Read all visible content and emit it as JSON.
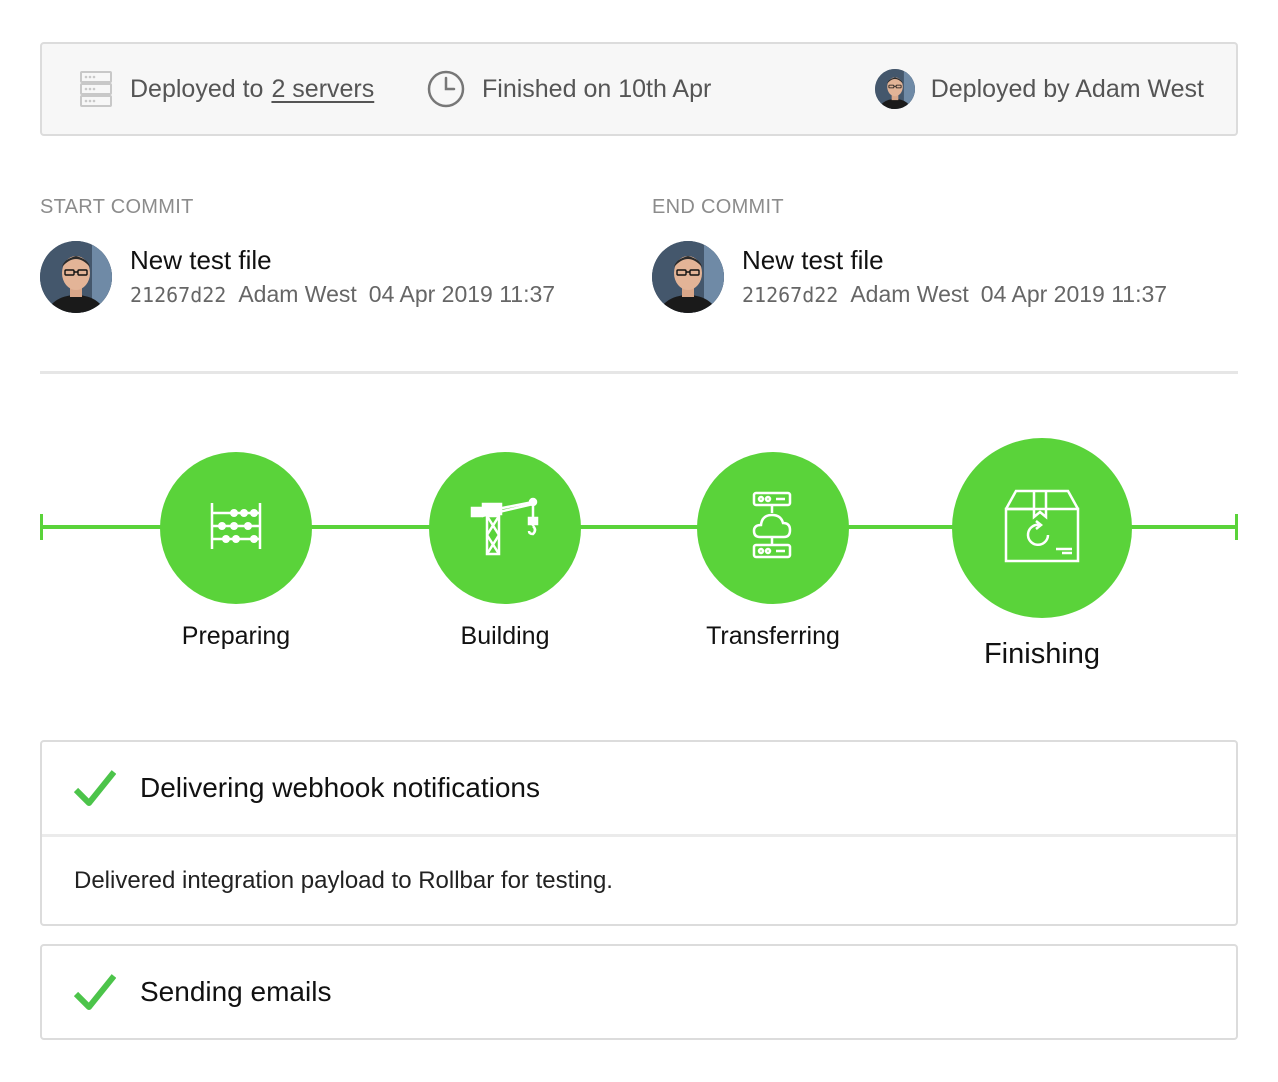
{
  "summary": {
    "deployed_to_prefix": "Deployed to",
    "servers_link": "2 servers",
    "finished": "Finished on 10th Apr",
    "deployed_by": "Deployed by Adam West",
    "icons": {
      "servers": "server-stack-icon",
      "finished": "clock-icon",
      "deployer": "avatar"
    }
  },
  "commits": {
    "start": {
      "label": "START COMMIT",
      "message": "New test file",
      "hash": "21267d22",
      "author": "Adam West",
      "date": "04 Apr 2019 11:37"
    },
    "end": {
      "label": "END COMMIT",
      "message": "New test file",
      "hash": "21267d22",
      "author": "Adam West",
      "date": "04 Apr 2019 11:37"
    }
  },
  "pipeline": {
    "stages": [
      {
        "label": "Preparing",
        "icon": "abacus-icon",
        "status": "complete"
      },
      {
        "label": "Building",
        "icon": "crane-icon",
        "status": "complete"
      },
      {
        "label": "Transferring",
        "icon": "cloud-transfer-icon",
        "status": "complete"
      },
      {
        "label": "Finishing",
        "icon": "package-refresh-icon",
        "status": "current"
      }
    ],
    "accent_color": "#5ad33a"
  },
  "steps": [
    {
      "title": "Delivering webhook notifications",
      "detail": "Delivered integration payload to Rollbar for testing.",
      "status": "success",
      "icon": "check-icon"
    },
    {
      "title": "Sending emails",
      "status": "success",
      "icon": "check-icon"
    }
  ]
}
